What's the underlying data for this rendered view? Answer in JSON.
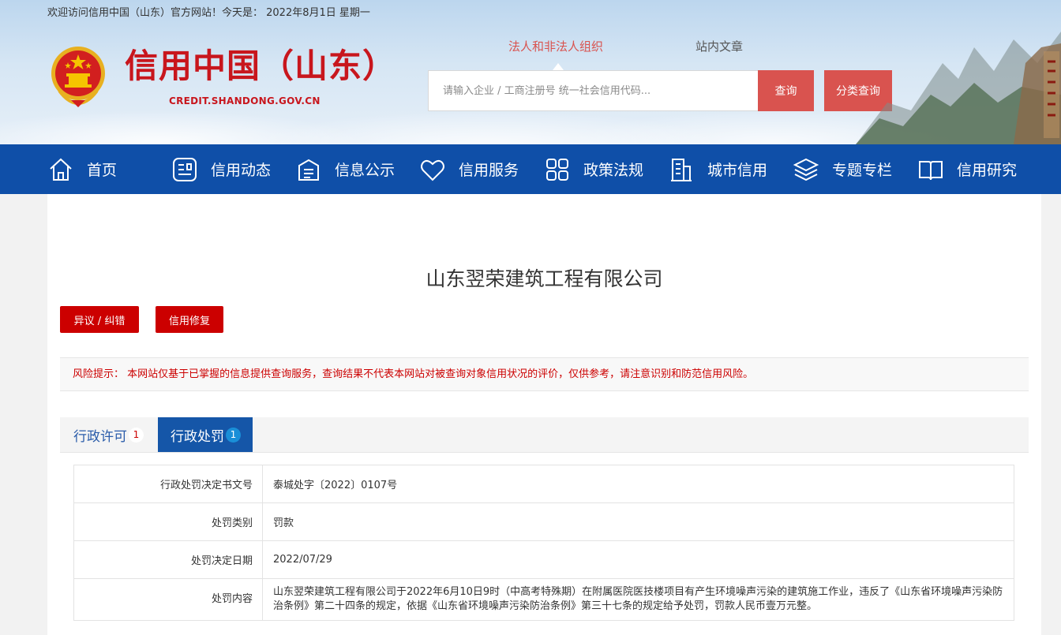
{
  "header": {
    "welcome": "欢迎访问信用中国（山东）官方网站！今天是： 2022年8月1日 星期一",
    "site_name": "信用中国（山东）",
    "site_domain": "CREDIT.SHANDONG.GOV.CN",
    "search_tabs": [
      "法人和非法人组织",
      "站内文章"
    ],
    "search_placeholder": "请输入企业 / 工商注册号 统一社会信用代码...",
    "search_button": "查询",
    "category_button": "分类查询"
  },
  "nav": {
    "items": [
      {
        "label": "首页",
        "icon": "home-icon"
      },
      {
        "label": "信用动态",
        "icon": "news-icon"
      },
      {
        "label": "信息公示",
        "icon": "notice-icon"
      },
      {
        "label": "信用服务",
        "icon": "heart-icon"
      },
      {
        "label": "政策法规",
        "icon": "grid-icon"
      },
      {
        "label": "城市信用",
        "icon": "building-icon"
      },
      {
        "label": "专题专栏",
        "icon": "layers-icon"
      },
      {
        "label": "信用研究",
        "icon": "book-icon"
      }
    ]
  },
  "main": {
    "company_name": "山东翌荣建筑工程有限公司",
    "objection_button": "异议 / 纠错",
    "repair_button": "信用修复",
    "risk_notice": "风险提示： 本网站仅基于已掌握的信息提供查询服务，查询结果不代表本网站对被查询对象信用状况的评价，仅供参考，请注意识别和防范信用风险。",
    "tabs": [
      {
        "label": "行政许可",
        "count": "1"
      },
      {
        "label": "行政处罚",
        "count": "1"
      }
    ],
    "details": [
      {
        "key": "行政处罚决定书文号",
        "value": "泰城处字〔2022〕0107号"
      },
      {
        "key": "处罚类别",
        "value": "罚款"
      },
      {
        "key": "处罚决定日期",
        "value": "2022/07/29"
      },
      {
        "key": "处罚内容",
        "value": "山东翌荣建筑工程有限公司于2022年6月10日9时（中高考特殊期）在附属医院医技楼项目有产生环境噪声污染的建筑施工作业，违反了《山东省环境噪声污染防治条例》第二十四条的规定，依据《山东省环境噪声污染防治条例》第三十七条的规定给予处罚，罚款人民币壹万元整。"
      }
    ]
  },
  "colors": {
    "brand_red": "#c8161d",
    "button_red": "#d9534f",
    "nav_blue": "#0f4fa8",
    "tab_blue": "#1556a8"
  }
}
